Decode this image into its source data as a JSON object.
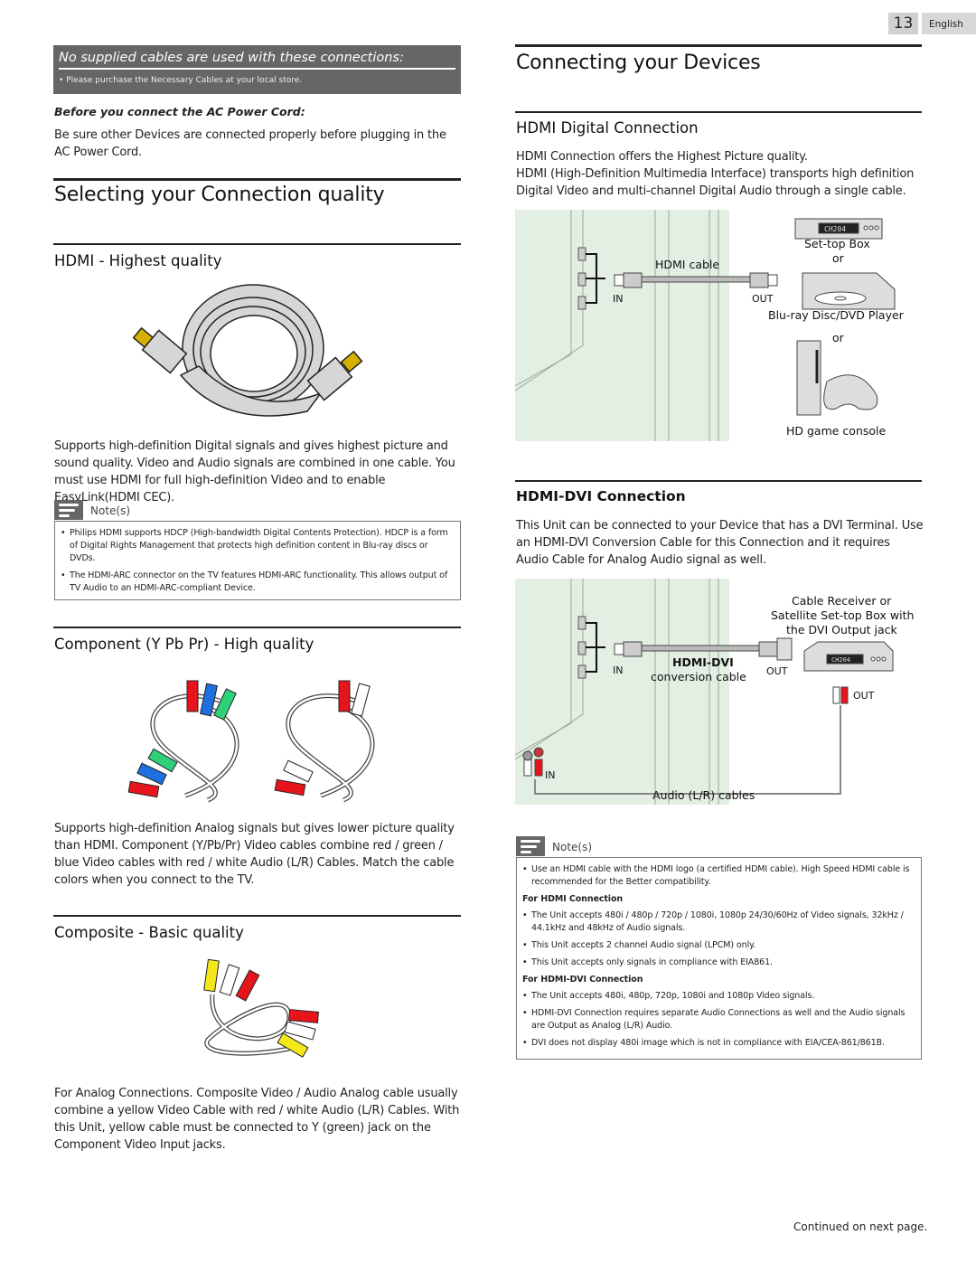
{
  "page": {
    "number": "13",
    "language": "English"
  },
  "left": {
    "notice": {
      "title": "No supplied cables are used with these connections:",
      "bullet": "Please purchase the Necessary Cables at your local store."
    },
    "before": {
      "heading": "Before you connect the AC Power Cord:",
      "text": "Be sure other Devices are connected properly before plugging in the AC Power Cord."
    },
    "title": "Selecting your Connection quality",
    "hdmi": {
      "heading": "HDMI - Highest quality",
      "text": "Supports high-definition Digital signals and gives highest picture and sound quality. Video and Audio signals are combined in one cable. You must use HDMI for full high-definition Video and to enable EasyLink(HDMI CEC).",
      "notes_label": "Note(s)",
      "notes": [
        "Philips HDMI supports HDCP (High-bandwidth Digital Contents Protection). HDCP is a form of Digital Rights Management that protects high definition content in Blu-ray discs or DVDs.",
        "The HDMI-ARC connector on the TV features HDMI-ARC functionality. This allows output of TV Audio to an HDMI-ARC-compliant Device."
      ]
    },
    "component": {
      "heading": "Component (Y Pb Pr) - High quality",
      "text": "Supports high-definition Analog signals but gives lower picture quality than HDMI. Component (Y/Pb/Pr) Video cables combine red / green / blue Video cables with red / white Audio (L/R) Cables. Match the cable colors when you connect to the TV."
    },
    "composite": {
      "heading": "Composite - Basic quality",
      "text": "For Analog Connections. Composite Video / Audio Analog cable usually combine a yellow Video Cable with red / white Audio (L/R) Cables. With this Unit, yellow cable must be connected to Y (green) jack on the Component Video Input jacks."
    }
  },
  "right": {
    "title": "Connecting your Devices",
    "hdmi_digital": {
      "heading": "HDMI Digital Connection",
      "lines": [
        "HDMI Connection offers the Highest Picture quality.",
        "HDMI (High-Definition Multimedia Interface) transports high definition Digital Video and multi-channel Digital Audio through a single cable."
      ],
      "diagram": {
        "cable_label": "HDMI cable",
        "in_label": "IN",
        "out_label": "OUT",
        "device1": "Set-top Box",
        "or1": "or",
        "device2": "Blu-ray Disc/DVD Player",
        "or2": "or",
        "device3": "HD game console",
        "display_text": "CH204"
      }
    },
    "hdmi_dvi": {
      "heading": "HDMI-DVI Connection",
      "text": "This Unit can be connected to your Device that has a DVI Terminal. Use an HDMI-DVI Conversion Cable for this Connection and it requires Audio Cable for Analog Audio signal as well.",
      "diagram": {
        "device_line1": "Cable Receiver or",
        "device_line2": "Satellite Set-top Box with",
        "device_line3": "the DVI Output jack",
        "cable_label_1": "HDMI-DVI",
        "cable_label_2": "conversion cable",
        "in_label": "IN",
        "out_label": "OUT",
        "audio_out_label": "OUT",
        "audio_in_label": "IN",
        "audio_cable_label": "Audio (L/R) cables",
        "display_text": "CH204"
      }
    },
    "notes_label": "Note(s)",
    "notes": {
      "general": "Use an HDMI cable with the HDMI logo (a certified HDMI cable). High Speed HDMI cable is recommended for the Better compatibility.",
      "hdmi_heading": "For HDMI Connection",
      "hdmi_items": [
        "The Unit accepts 480i / 480p / 720p / 1080i, 1080p 24/30/60Hz of Video signals, 32kHz / 44.1kHz and 48kHz of Audio signals.",
        "This Unit accepts 2 channel Audio signal (LPCM) only.",
        "This Unit accepts only signals in compliance with EIA861."
      ],
      "dvi_heading": "For HDMI-DVI Connection",
      "dvi_items": [
        "The Unit accepts 480i, 480p, 720p, 1080i and 1080p Video signals.",
        "HDMI-DVI Connection requires separate Audio Connections as well and the Audio signals are Output as Analog (L/R) Audio.",
        "DVI does not display 480i image which is not in compliance with EIA/CEA-861/861B."
      ]
    },
    "footer": "Continued on next page."
  },
  "colors": {
    "panel": "#666666",
    "tv_green": "#e3efe3",
    "rca_red": "#e8141c",
    "rca_green": "#2fd07a",
    "rca_blue": "#1e6fe0",
    "rca_yellow": "#f4e81a",
    "hdmi_gold": "#d4b000"
  }
}
